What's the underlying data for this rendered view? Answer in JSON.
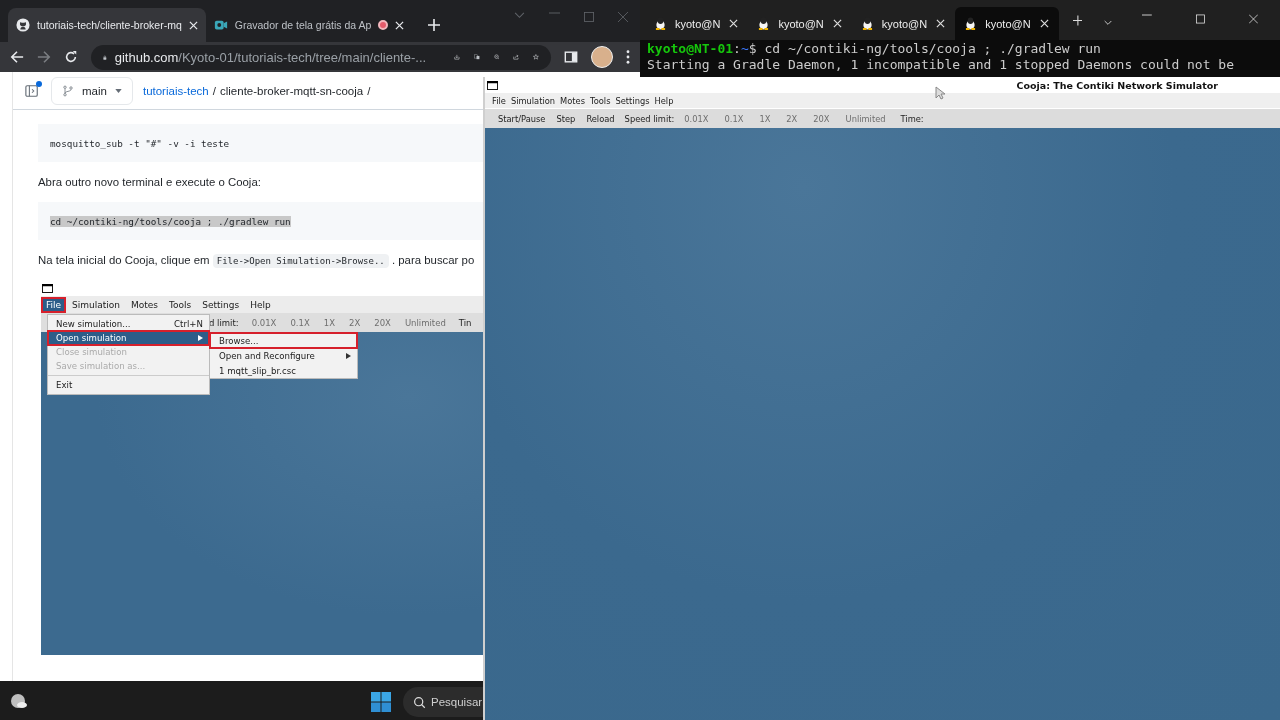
{
  "browser": {
    "tabs": [
      {
        "title": "tutoriais-tech/cliente-broker-mq",
        "selected": true,
        "kind": "github"
      },
      {
        "title": "Gravador de tela grátis da Ap",
        "selected": false,
        "kind": "recorder",
        "recording": true
      }
    ],
    "address": {
      "host": "github.com",
      "path": "/Kyoto-01/tutoriais-tech/tree/main/cliente-..."
    },
    "repo_header": {
      "sidebar_notification": true,
      "branch": "main",
      "breadcrumb": [
        {
          "kind": "link",
          "text": "tutoriais-tech"
        },
        {
          "kind": "separator",
          "text": "/"
        },
        {
          "kind": "current",
          "text": "cliente-broker-mqtt-sn-cooja"
        },
        {
          "kind": "separator",
          "text": "/"
        }
      ]
    },
    "content": [
      {
        "kind": "code",
        "text": "mosquitto_sub -t \"#\" -v -i teste",
        "selected": false
      },
      {
        "kind": "paragraph",
        "parts": [
          {
            "kind": "text",
            "text": "Abra outro novo terminal e execute o Cooja:"
          }
        ]
      },
      {
        "kind": "code",
        "text": "cd ~/contiki-ng/tools/cooja ; ./gradlew run",
        "selected": true
      },
      {
        "kind": "paragraph",
        "parts": [
          {
            "kind": "text",
            "text": "Na tela inicial do Cooja, clique em"
          },
          {
            "kind": "code",
            "text": "File->Open Simulation->Browse.."
          },
          {
            "kind": "text",
            "text": ". para buscar po"
          }
        ]
      },
      {
        "kind": "screenshot",
        "menu": [
          {
            "label": "File",
            "marked": true
          },
          {
            "label": "Simulation",
            "marked": false
          },
          {
            "label": "Motes",
            "marked": false
          },
          {
            "label": "Tools",
            "marked": false
          },
          {
            "label": "Settings",
            "marked": false
          },
          {
            "label": "Help",
            "marked": false
          }
        ],
        "toolbar": [
          {
            "label": "d limit:",
            "kind": "label",
            "disabled": false
          },
          {
            "label": "0.01X",
            "kind": "button",
            "disabled": true
          },
          {
            "label": "0.1X",
            "kind": "button",
            "disabled": true
          },
          {
            "label": "1X",
            "kind": "button",
            "disabled": true
          },
          {
            "label": "2X",
            "kind": "button",
            "disabled": true
          },
          {
            "label": "20X",
            "kind": "button",
            "disabled": true
          },
          {
            "label": "Unlimited",
            "kind": "button",
            "disabled": true
          },
          {
            "label": "Tin",
            "kind": "label",
            "disabled": false
          }
        ],
        "file_menu": [
          {
            "kind": "item",
            "label": "New simulation...",
            "shortcut": "Ctrl+N",
            "disabled": false,
            "selected": false,
            "marked": false,
            "submenu": false
          },
          {
            "kind": "item",
            "label": "Open simulation",
            "disabled": false,
            "selected": true,
            "marked": true,
            "submenu": true
          },
          {
            "kind": "item",
            "label": "Close simulation",
            "disabled": true,
            "selected": false,
            "marked": false,
            "submenu": false
          },
          {
            "kind": "item",
            "label": "Save simulation as...",
            "disabled": true,
            "selected": false,
            "marked": false,
            "submenu": false
          },
          {
            "kind": "separator"
          },
          {
            "kind": "item",
            "label": "Exit",
            "disabled": false,
            "selected": false,
            "marked": false,
            "submenu": false
          }
        ],
        "submenu": [
          {
            "label": "Browse...",
            "marked": true,
            "submenu": false
          },
          {
            "label": "Open and Reconfigure",
            "marked": false,
            "submenu": true
          },
          {
            "label": "1 mqtt_slip_br.csc",
            "marked": false,
            "submenu": false
          }
        ]
      }
    ]
  },
  "terminal": {
    "tabs": [
      {
        "label": "kyoto@N",
        "selected": false
      },
      {
        "label": "kyoto@N",
        "selected": false
      },
      {
        "label": "kyoto@N",
        "selected": false
      },
      {
        "label": "kyoto@N",
        "selected": true
      }
    ],
    "lines": [
      {
        "kind": "prompt",
        "user": "kyoto@NT-01",
        "separator": ":",
        "path": "~",
        "symbol": "$",
        "command": "cd ~/contiki-ng/tools/cooja ; ./gradlew run"
      },
      {
        "kind": "output",
        "text": "Starting a Gradle Daemon, 1 incompatible and 1 stopped Daemons could not be"
      }
    ]
  },
  "cooja": {
    "title": "Cooja: The Contiki Network Simulator",
    "menu": [
      "File",
      "Simulation",
      "Motes",
      "Tools",
      "Settings",
      "Help"
    ],
    "toolbar": [
      {
        "label": "Start/Pause",
        "kind": "button",
        "disabled": false
      },
      {
        "label": "Step",
        "kind": "button",
        "disabled": false
      },
      {
        "label": "Reload",
        "kind": "button",
        "disabled": false
      },
      {
        "label": "Speed limit:",
        "kind": "label",
        "disabled": false
      },
      {
        "label": "0.01X",
        "kind": "button",
        "disabled": true
      },
      {
        "label": "0.1X",
        "kind": "button",
        "disabled": true
      },
      {
        "label": "1X",
        "kind": "button",
        "disabled": true
      },
      {
        "label": "2X",
        "kind": "button",
        "disabled": true
      },
      {
        "label": "20X",
        "kind": "button",
        "disabled": true
      },
      {
        "label": "Unlimited",
        "kind": "button",
        "disabled": true
      },
      {
        "label": "Time:",
        "kind": "label",
        "disabled": false
      }
    ]
  },
  "taskbar": {
    "search": {
      "placeholder": "Pesquisar"
    }
  }
}
